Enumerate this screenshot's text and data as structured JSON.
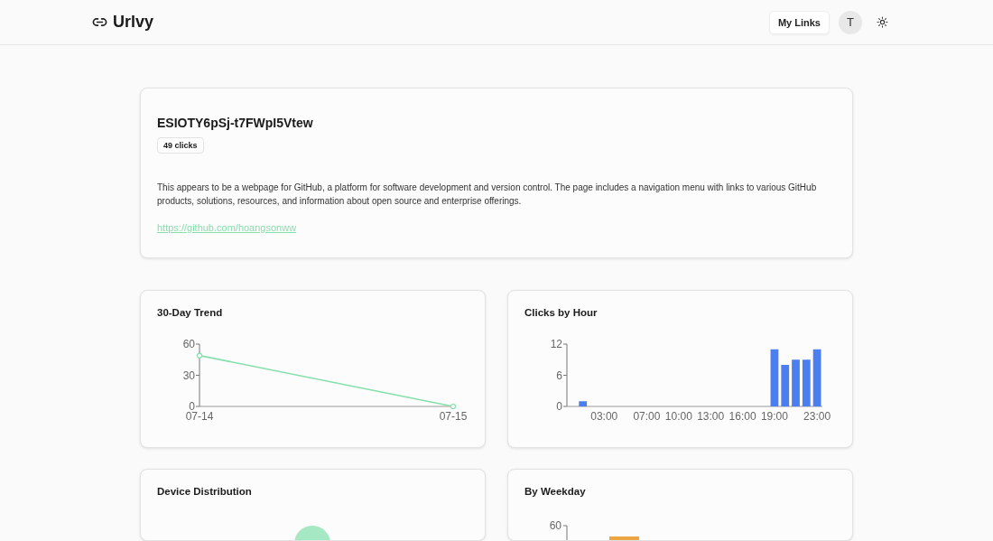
{
  "header": {
    "logo": "Urlvy",
    "my_links": "My Links",
    "avatar": "T"
  },
  "link": {
    "code": "ESIOTY6pSj-t7FWpI5Vtew",
    "clicks": "49 clicks",
    "description": "This appears to be a webpage for GitHub, a platform for software development and version control. The page includes a navigation menu with links to various GitHub products, solutions, resources, and information about open source and enterprise offerings.",
    "url": "https://github.com/hoangsonww"
  },
  "trend": {
    "title": "30-Day Trend",
    "chart_data": {
      "type": "line",
      "categories": [
        "07-14",
        "07-15"
      ],
      "series": [
        {
          "color": "#86dfad",
          "marker": "circle",
          "values": [
            49,
            0
          ]
        }
      ],
      "ylim": [
        0,
        60
      ],
      "yticks": [
        0,
        30,
        60
      ]
    }
  },
  "hours": {
    "title": "Clicks by Hour",
    "chart_data": {
      "type": "bar",
      "x": [
        1,
        19,
        20,
        21,
        22,
        23
      ],
      "series": [
        {
          "color": "#4b7ff0",
          "values": [
            1,
            11,
            8,
            9,
            9,
            11
          ]
        }
      ],
      "xlim": [
        -0.5,
        23.5
      ],
      "ylim": [
        0,
        12
      ],
      "yticks": [
        0,
        6,
        12
      ],
      "xticks": [
        {
          "value": 3,
          "label": "03:00"
        },
        {
          "value": 7,
          "label": "07:00"
        },
        {
          "value": 10,
          "label": "10:00"
        },
        {
          "value": 13,
          "label": "13:00"
        },
        {
          "value": 16,
          "label": "16:00"
        },
        {
          "value": 19,
          "label": "19:00"
        },
        {
          "value": 23,
          "label": "23:00"
        }
      ]
    }
  },
  "devices": {
    "title": "Device Distribution"
  },
  "weekday": {
    "title": "By Weekday",
    "y_tick": "60"
  }
}
